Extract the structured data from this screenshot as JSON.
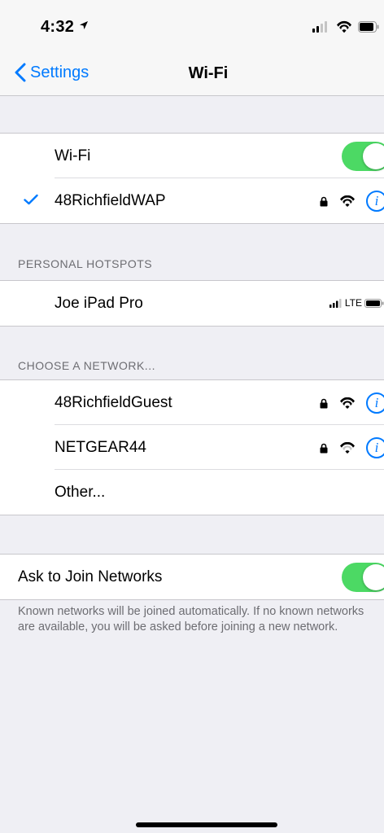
{
  "status_bar": {
    "time": "4:32"
  },
  "nav": {
    "back_label": "Settings",
    "title": "Wi-Fi"
  },
  "wifi_group": {
    "toggle_label": "Wi-Fi",
    "toggle_on": true,
    "connected_network": "48RichfieldWAP"
  },
  "hotspots": {
    "header": "PERSONAL HOTSPOTS",
    "items": [
      {
        "name": "Joe iPad Pro",
        "network_type": "LTE"
      }
    ]
  },
  "choose_network": {
    "header": "CHOOSE A NETWORK...",
    "networks": [
      {
        "name": "48RichfieldGuest",
        "locked": true
      },
      {
        "name": "NETGEAR44",
        "locked": true
      }
    ],
    "other_label": "Other..."
  },
  "ask_to_join": {
    "label": "Ask to Join Networks",
    "toggle_on": true,
    "footer": "Known networks will be joined automatically. If no known networks are available, you will be asked before joining a new network."
  },
  "colors": {
    "accent": "#007aff",
    "toggle_on": "#4cd964",
    "background": "#efeff4"
  }
}
